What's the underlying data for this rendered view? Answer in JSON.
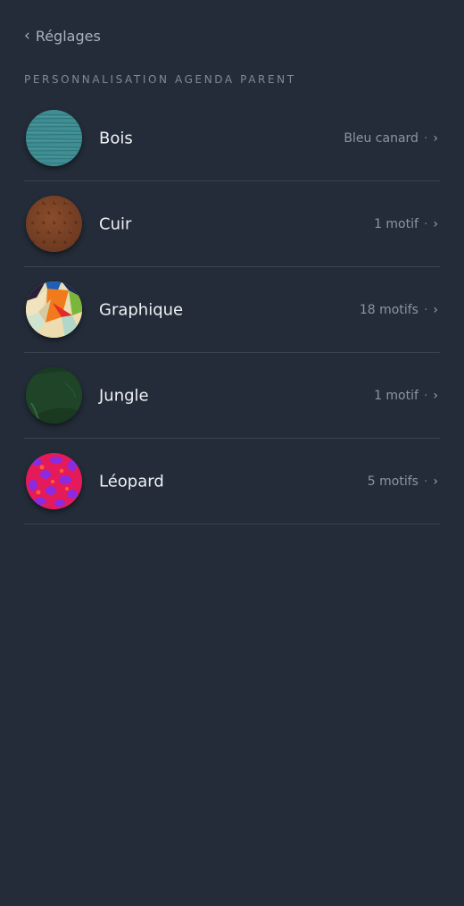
{
  "nav": {
    "back_label": "Réglages",
    "back_icon": "chevron-left-icon"
  },
  "section": {
    "title": "PERSONNALISATION AGENDA PARENT"
  },
  "items": [
    {
      "label": "Bois",
      "detail": "Bleu canard",
      "icon": "bois-texture-swatch",
      "color": "#3f8e93"
    },
    {
      "label": "Cuir",
      "detail": "1 motif",
      "icon": "cuir-texture-swatch",
      "color": "#7a4327"
    },
    {
      "label": "Graphique",
      "detail": "18 motifs",
      "icon": "graphique-pattern-swatch",
      "color": "#e8dcb0"
    },
    {
      "label": "Jungle",
      "detail": "1 motif",
      "icon": "jungle-pattern-swatch",
      "color": "#1f4428"
    },
    {
      "label": "Léopard",
      "detail": "5 motifs",
      "icon": "leopard-pattern-swatch",
      "color": "#e0185a"
    }
  ],
  "separators": {
    "dot": "·",
    "chevron": "›"
  }
}
